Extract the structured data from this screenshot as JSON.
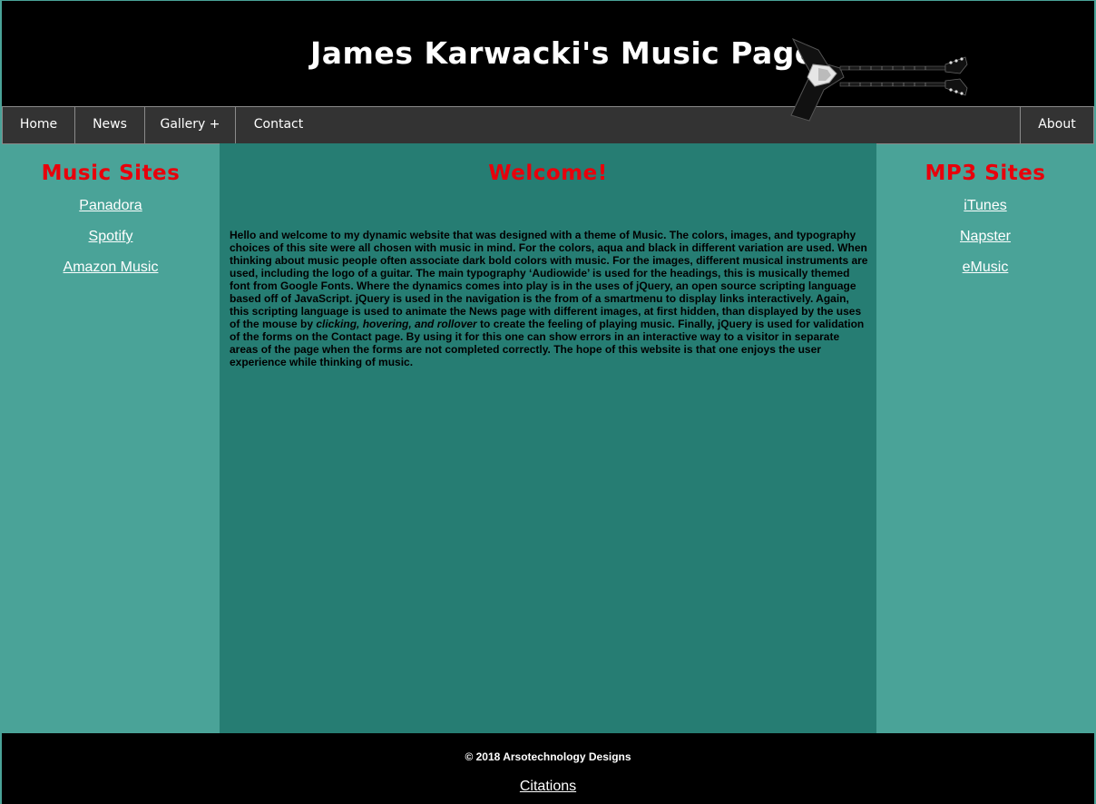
{
  "header": {
    "title": "James Karwacki's Music Page"
  },
  "nav": {
    "home": "Home",
    "news": "News",
    "gallery": "Gallery +",
    "contact": "Contact",
    "about": "About"
  },
  "left_sidebar": {
    "heading": "Music Sites",
    "links": [
      "Panadora",
      "Spotify",
      "Amazon Music"
    ]
  },
  "right_sidebar": {
    "heading": "MP3 Sites",
    "links": [
      "iTunes",
      "Napster",
      "eMusic"
    ]
  },
  "main": {
    "heading": "Welcome!",
    "intro_part1": "Hello and welcome to my dynamic website that was designed with a theme of Music. The colors, images, and typography choices of this site were all chosen with music in mind. For the colors, aqua and black in different variation are used. When thinking about music people often associate dark bold colors with music. For the images, different musical instruments are used, including the logo of a guitar. The main typography ‘Audiowide’ is used for the headings, this is musically themed font from Google Fonts. Where the dynamics comes into play is in the uses of jQuery, an open source scripting language based off of JavaScript. jQuery is used in the navigation is the from of a smartmenu to display links interactively. Again, this scripting language is used to animate the News page with different images, at first hidden, than displayed by the uses of the mouse by ",
    "intro_emphasis": "clicking, hovering, and rollover",
    "intro_part2": " to create the feeling of playing music. Finally, jQuery is used for validation of the forms on the Contact page. By using it for this one can show errors in an interactive way to a visitor in separate areas of the page when the forms are not completed correctly. The hope of this website is that one enjoys the user experience while thinking of music."
  },
  "footer": {
    "copyright": "© 2018 Arsotechnology Designs",
    "citations": "Citations"
  },
  "colors": {
    "banner": "#000000",
    "nav": "#333333",
    "sidebar": "#4aa398",
    "content": "#267d73",
    "heading_red": "#e8000b"
  },
  "icons": {
    "logo": "guitar-icon"
  }
}
